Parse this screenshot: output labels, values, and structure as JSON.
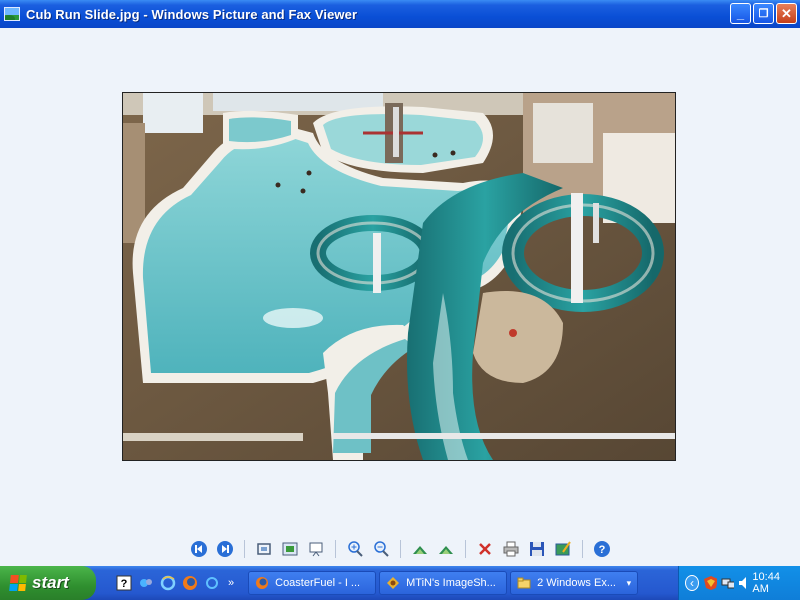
{
  "window": {
    "title": "Cub Run Slide.jpg - Windows Picture and Fax Viewer",
    "minimize": "_",
    "restore": "❐",
    "close": "✕"
  },
  "photo": {
    "subject": "indoor water park with teal water slide"
  },
  "toolbar": {
    "buttons": [
      {
        "name": "previous-image-button",
        "icon": "prev-icon"
      },
      {
        "name": "next-image-button",
        "icon": "next-icon"
      },
      {
        "name": "best-fit-button",
        "icon": "best-fit-icon"
      },
      {
        "name": "actual-size-button",
        "icon": "actual-size-icon"
      },
      {
        "name": "slideshow-button",
        "icon": "slideshow-icon"
      },
      {
        "name": "zoom-in-button",
        "icon": "zoom-in-icon"
      },
      {
        "name": "zoom-out-button",
        "icon": "zoom-out-icon"
      },
      {
        "name": "rotate-clockwise-button",
        "icon": "rotate-cw-icon"
      },
      {
        "name": "rotate-counterclockwise-button",
        "icon": "rotate-ccw-icon"
      },
      {
        "name": "delete-button",
        "icon": "delete-icon"
      },
      {
        "name": "print-button",
        "icon": "print-icon"
      },
      {
        "name": "save-button",
        "icon": "save-icon"
      },
      {
        "name": "edit-button",
        "icon": "edit-icon"
      },
      {
        "name": "help-button",
        "icon": "help-icon"
      }
    ]
  },
  "taskbar": {
    "start_label": "start",
    "quick_launch_more": "»",
    "tasks": [
      {
        "label": "CoasterFuel - I ...",
        "icon": "firefox-icon"
      },
      {
        "label": "MTiN's ImageSh...",
        "icon": "imageshack-icon"
      },
      {
        "label": "2 Windows Ex...",
        "icon": "folder-icon",
        "group_arrow": "▾"
      }
    ],
    "tray_expand": "‹",
    "clock": "10:44 AM"
  },
  "colors": {
    "titlebar": "#0a4fd6",
    "taskbar": "#2558cf",
    "start": "#2f8f2f",
    "viewer_bg": "#eef3fa",
    "water": "#62c3c9",
    "slide": "#1e8f8f"
  }
}
